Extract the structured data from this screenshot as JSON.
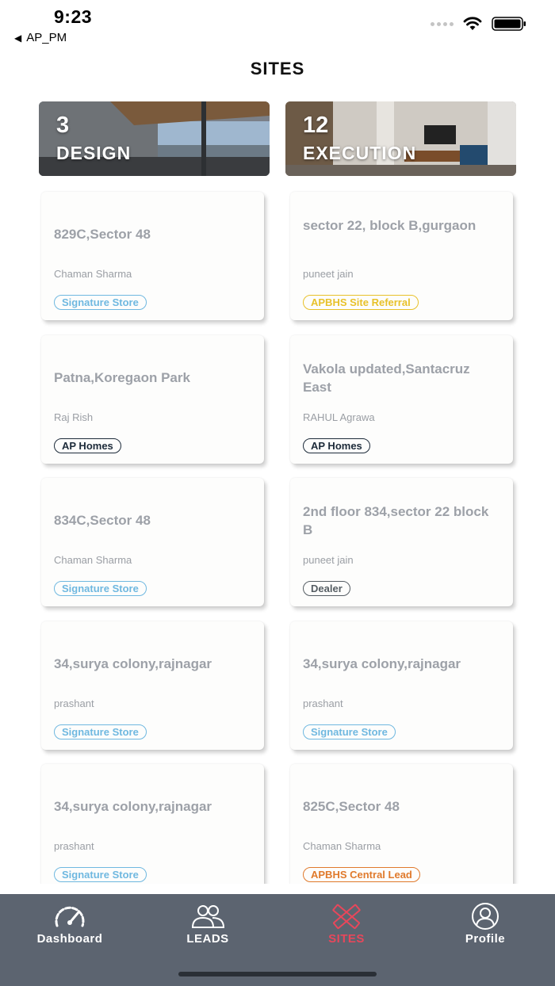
{
  "status_bar": {
    "time": "9:23",
    "back_app": "AP_PM",
    "back_icon": "back-triangle-icon",
    "wifi_icon": "wifi-icon",
    "battery_icon": "battery-icon"
  },
  "page": {
    "title": "SITES"
  },
  "categories": [
    {
      "count": "3",
      "label": "DESIGN"
    },
    {
      "count": "12",
      "label": "EXECUTION"
    }
  ],
  "sites": [
    {
      "address": "829C,Sector 48",
      "owner": "Chaman Sharma",
      "tag": "Signature Store",
      "tag_type": "signature"
    },
    {
      "address": "sector 22, block B,gurgaon",
      "owner": "puneet jain",
      "tag": "APBHS Site Referral",
      "tag_type": "referral"
    },
    {
      "address": "Patna,Koregaon Park",
      "owner": "Raj Rish",
      "tag": "AP Homes",
      "tag_type": "aphomes"
    },
    {
      "address": "Vakola updated,Santacruz East",
      "owner": "RAHUL Agrawa",
      "tag": "AP Homes",
      "tag_type": "aphomes"
    },
    {
      "address": "834C,Sector 48",
      "owner": "Chaman Sharma",
      "tag": "Signature Store",
      "tag_type": "signature"
    },
    {
      "address": "2nd floor 834,sector 22 block B",
      "owner": "puneet jain",
      "tag": "Dealer",
      "tag_type": "dealer"
    },
    {
      "address": "34,surya colony,rajnagar",
      "owner": "prashant",
      "tag": "Signature Store",
      "tag_type": "signature"
    },
    {
      "address": "34,surya colony,rajnagar",
      "owner": "prashant",
      "tag": "Signature Store",
      "tag_type": "signature"
    },
    {
      "address": "34,surya colony,rajnagar",
      "owner": "prashant",
      "tag": "Signature Store",
      "tag_type": "signature"
    },
    {
      "address": "825C,Sector 48",
      "owner": "Chaman Sharma",
      "tag": "APBHS Central Lead",
      "tag_type": "central"
    }
  ],
  "tabbar": {
    "active": "SITES",
    "tabs": [
      {
        "label": "Dashboard",
        "icon": "speedometer-icon"
      },
      {
        "label": "LEADS",
        "icon": "users-icon"
      },
      {
        "label": "SITES",
        "icon": "pencil-ruler-icon"
      },
      {
        "label": "Profile",
        "icon": "profile-icon"
      }
    ]
  },
  "colors": {
    "tabbar_bg": "#5c6470",
    "active_tab": "#e8475b",
    "signature": "#6fb8e0",
    "referral": "#e8c12a",
    "aphomes": "#1d2b3a",
    "dealer": "#555d63",
    "central": "#e07a2c"
  }
}
